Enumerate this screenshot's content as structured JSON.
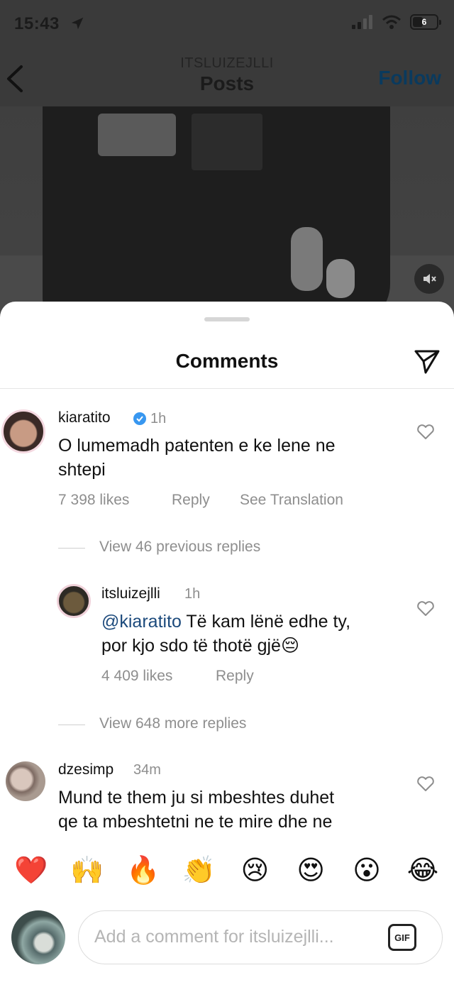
{
  "status_bar": {
    "time": "15:43",
    "battery": "6"
  },
  "nav": {
    "username": "ITSLUIZEJLLI",
    "title": "Posts",
    "follow_label": "Follow"
  },
  "sheet": {
    "title": "Comments"
  },
  "comments": [
    {
      "user": "kiaratito",
      "verified": true,
      "time": "1h",
      "text_line1": "O lumemadh patenten e ke lene ne",
      "text_line2": "shtepi",
      "likes": "7 398 likes",
      "reply_label": "Reply",
      "translate_label": "See Translation"
    },
    {
      "user": "itsluizejlli",
      "time": "1h",
      "mention": "@kiaratito",
      "text_line1": " Të kam lënë edhe ty,",
      "text_line2": "por kjo sdo të thotë gjë😔",
      "likes": "4 409 likes",
      "reply_label": "Reply"
    },
    {
      "user": "dzesimp",
      "time": "34m",
      "text_line1": "Mund te them ju si mbeshtes duhet",
      "text_line2": "qe ta mbeshtetni ne te mire dhe ne"
    }
  ],
  "view_replies": [
    "View 46 previous replies",
    "View 648 more replies"
  ],
  "emojis": [
    "❤️",
    "🙌",
    "🔥",
    "👏",
    "😢",
    "😍",
    "😮",
    "😂"
  ],
  "composer": {
    "placeholder": "Add a comment for itsluizejlli...",
    "gif_label": "GIF"
  }
}
